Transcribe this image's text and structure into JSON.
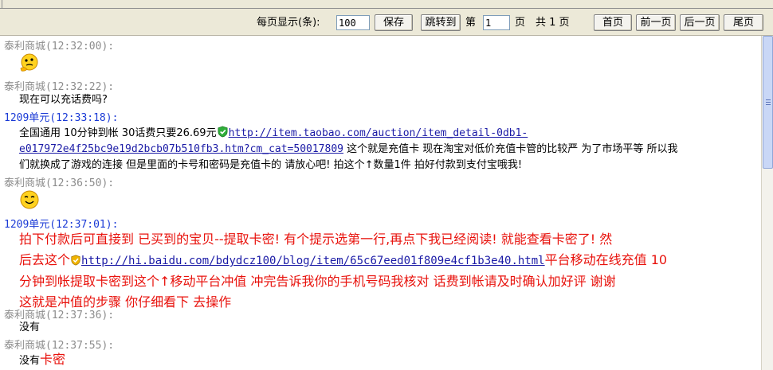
{
  "toolbar": {
    "per_page_label": "每页显示(条):",
    "per_page_value": "100",
    "save_label": "保存",
    "jump_label": "跳转到",
    "page_prefix": "第",
    "page_value": "1",
    "page_suffix": "页",
    "total_label": "共 1 页",
    "first_label": "首页",
    "prev_label": "前一页",
    "next_label": "后一页",
    "last_label": "尾页"
  },
  "messages": [
    {
      "sender": "泰利商城(12:32:00):",
      "type": "emoticon",
      "icon": "thinking-face-icon"
    },
    {
      "sender": "泰利商城(12:32:22):",
      "type": "text",
      "text": "现在可以充话费吗?"
    },
    {
      "sender": "1209单元(12:33:18):",
      "type": "rich",
      "line1_prefix": "全国通用 10分钟到帐 30话费只要26.69元",
      "link": "http://item.taobao.com/auction/item_detail-0db1-",
      "link_cont": "e017972e4f25bc9e19d2bcb07b510fb3.htm?cm_cat=50017809",
      "after_link": " 这个就是充值卡 现在淘宝对低价充值卡管的比较严 为了市场平等 所以我",
      "line3": "们就换成了游戏的连接 但是里面的卡号和密码是充值卡的 请放心吧! 拍这个↑数量1件 拍好付款到支付宝哦我!"
    },
    {
      "sender": "泰利商城(12:36:50):",
      "type": "emoticon",
      "icon": "smile-face-icon"
    },
    {
      "sender": "1209单元(12:37:01):",
      "type": "big",
      "line1": "拍下付款后可直接到  已买到的宝贝--提取卡密! 有个提示选第一行,再点下我已经阅读!  就能查看卡密了!  然",
      "line2_prefix": "后去这个",
      "link": "http://hi.baidu.com/bdydcz100/blog/item/65c67eed01f809e4cf1b3e40.html",
      "line2_suffix": "平台移动在线充值 10",
      "line3": "分钟到帐提取卡密到这个↑移动平台冲值  冲完告诉我你的手机号码我核对 话费到帐请及时确认加好评  谢谢",
      "line4": "这就是冲值的步骤 你仔细看下 去操作"
    },
    {
      "sender": "泰利商城(12:37:36):",
      "type": "text",
      "text": "没有"
    },
    {
      "sender": "泰利商城(12:37:55):",
      "type": "mixed",
      "text": "没有",
      "red": "卡密"
    }
  ]
}
